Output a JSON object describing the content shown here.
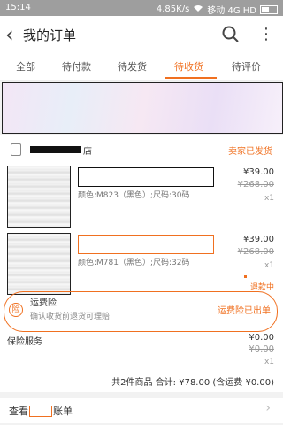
{
  "status_bar": {
    "time": "15:14",
    "speed": "4.85K/s",
    "carrier": "移动 4G HD"
  },
  "header": {
    "title": "我的订单"
  },
  "tabs": [
    {
      "label": "全部"
    },
    {
      "label": "待付款"
    },
    {
      "label": "待发货"
    },
    {
      "label": "待收货",
      "active": true
    },
    {
      "label": "待评价"
    }
  ],
  "order": {
    "store_suffix": "店",
    "status": "卖家已发货",
    "items": [
      {
        "attr": "颜色:M823（黑色）;尺码:30码",
        "price": "¥39.00",
        "original_price": "¥268.00",
        "qty": "x1"
      },
      {
        "attr": "颜色:M781（黑色）;尺码:32码",
        "price": "¥39.00",
        "original_price": "¥268.00",
        "qty": "x1",
        "refund_status": "退款中"
      }
    ],
    "insurance": {
      "icon": "险",
      "title": "运费险",
      "desc": "确认收货前退货可理赔",
      "status": "运费险已出单"
    },
    "service": {
      "title": "保险服务",
      "price": "¥0.00",
      "original_price": "¥0.00",
      "qty": "x1"
    },
    "summary": "共2件商品  合计: ¥78.00 (含运费 ¥0.00)",
    "view_bill": {
      "prefix": "查看",
      "suffix": "账单"
    }
  }
}
